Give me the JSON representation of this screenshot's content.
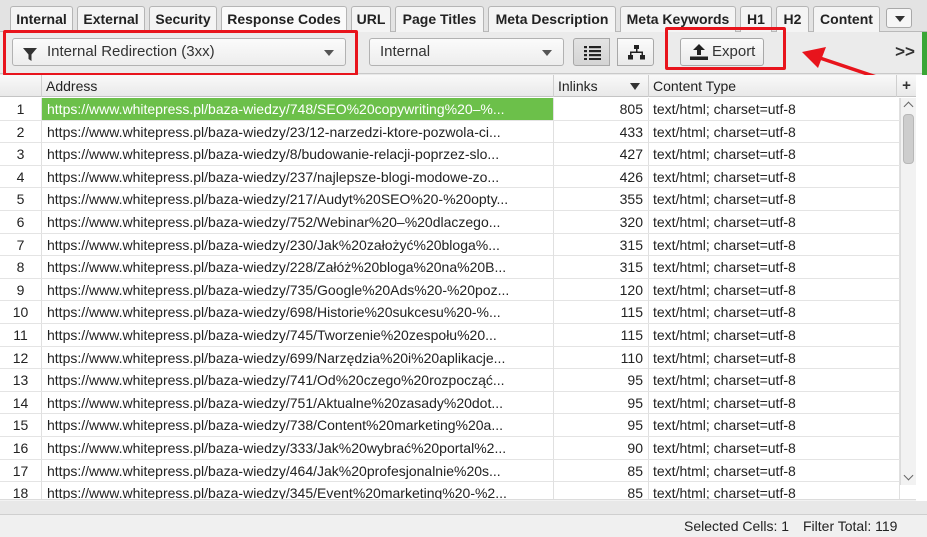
{
  "tabs": [
    {
      "label": "Internal",
      "active": false
    },
    {
      "label": "External",
      "active": false
    },
    {
      "label": "Security",
      "active": false
    },
    {
      "label": "Response Codes",
      "active": true
    },
    {
      "label": "URL",
      "active": false
    },
    {
      "label": "Page Titles",
      "active": false
    },
    {
      "label": "Meta Description",
      "active": false
    },
    {
      "label": "Meta Keywords",
      "active": false
    },
    {
      "label": "H1",
      "active": false
    },
    {
      "label": "H2",
      "active": false
    },
    {
      "label": "Content",
      "active": false
    }
  ],
  "toolbar": {
    "filter_value": "Internal Redirection (3xx)",
    "type_value": "Internal",
    "export_label": "Export",
    "more_label": ">>"
  },
  "icons": {
    "filter": "funnel-icon",
    "list_view": "list-view-icon",
    "tree_view": "tree-view-icon",
    "export": "upload-icon"
  },
  "annotation_color": "#e8141c",
  "selection_color": "#6cc04a",
  "table": {
    "columns": [
      "Address",
      "Inlinks",
      "Content Type"
    ],
    "add_column_label": "+",
    "rows": [
      {
        "num": "1",
        "address": "https://www.whitepress.pl/baza-wiedzy/748/SEO%20copywriting%20–%...",
        "inlinks": "805",
        "content_type": "text/html; charset=utf-8"
      },
      {
        "num": "2",
        "address": "https://www.whitepress.pl/baza-wiedzy/23/12-narzedzi-ktore-pozwola-ci...",
        "inlinks": "433",
        "content_type": "text/html; charset=utf-8"
      },
      {
        "num": "3",
        "address": "https://www.whitepress.pl/baza-wiedzy/8/budowanie-relacji-poprzez-slo...",
        "inlinks": "427",
        "content_type": "text/html; charset=utf-8"
      },
      {
        "num": "4",
        "address": "https://www.whitepress.pl/baza-wiedzy/237/najlepsze-blogi-modowe-zo...",
        "inlinks": "426",
        "content_type": "text/html; charset=utf-8"
      },
      {
        "num": "5",
        "address": "https://www.whitepress.pl/baza-wiedzy/217/Audyt%20SEO%20-%20opty...",
        "inlinks": "355",
        "content_type": "text/html; charset=utf-8"
      },
      {
        "num": "6",
        "address": "https://www.whitepress.pl/baza-wiedzy/752/Webinar%20–%20dlaczego...",
        "inlinks": "320",
        "content_type": "text/html; charset=utf-8"
      },
      {
        "num": "7",
        "address": "https://www.whitepress.pl/baza-wiedzy/230/Jak%20założyć%20bloga%...",
        "inlinks": "315",
        "content_type": "text/html; charset=utf-8"
      },
      {
        "num": "8",
        "address": "https://www.whitepress.pl/baza-wiedzy/228/Załóż%20bloga%20na%20B...",
        "inlinks": "315",
        "content_type": "text/html; charset=utf-8"
      },
      {
        "num": "9",
        "address": "https://www.whitepress.pl/baza-wiedzy/735/Google%20Ads%20-%20poz...",
        "inlinks": "120",
        "content_type": "text/html; charset=utf-8"
      },
      {
        "num": "10",
        "address": "https://www.whitepress.pl/baza-wiedzy/698/Historie%20sukcesu%20-%...",
        "inlinks": "115",
        "content_type": "text/html; charset=utf-8"
      },
      {
        "num": "11",
        "address": "https://www.whitepress.pl/baza-wiedzy/745/Tworzenie%20zespołu%20...",
        "inlinks": "115",
        "content_type": "text/html; charset=utf-8"
      },
      {
        "num": "12",
        "address": "https://www.whitepress.pl/baza-wiedzy/699/Narzędzia%20i%20aplikacje...",
        "inlinks": "110",
        "content_type": "text/html; charset=utf-8"
      },
      {
        "num": "13",
        "address": "https://www.whitepress.pl/baza-wiedzy/741/Od%20czego%20rozpocząć...",
        "inlinks": "95",
        "content_type": "text/html; charset=utf-8"
      },
      {
        "num": "14",
        "address": "https://www.whitepress.pl/baza-wiedzy/751/Aktualne%20zasady%20dot...",
        "inlinks": "95",
        "content_type": "text/html; charset=utf-8"
      },
      {
        "num": "15",
        "address": "https://www.whitepress.pl/baza-wiedzy/738/Content%20marketing%20a...",
        "inlinks": "95",
        "content_type": "text/html; charset=utf-8"
      },
      {
        "num": "16",
        "address": "https://www.whitepress.pl/baza-wiedzy/333/Jak%20wybrać%20portal%2...",
        "inlinks": "90",
        "content_type": "text/html; charset=utf-8"
      },
      {
        "num": "17",
        "address": "https://www.whitepress.pl/baza-wiedzy/464/Jak%20profesjonalnie%20s...",
        "inlinks": "85",
        "content_type": "text/html; charset=utf-8"
      },
      {
        "num": "18",
        "address": "https://www.whitepress.pl/baza-wiedzy/345/Event%20marketing%20-%2...",
        "inlinks": "85",
        "content_type": "text/html; charset=utf-8"
      }
    ]
  },
  "status": {
    "selected_cells": "Selected Cells: 1",
    "filter_total": "Filter Total: 119"
  }
}
